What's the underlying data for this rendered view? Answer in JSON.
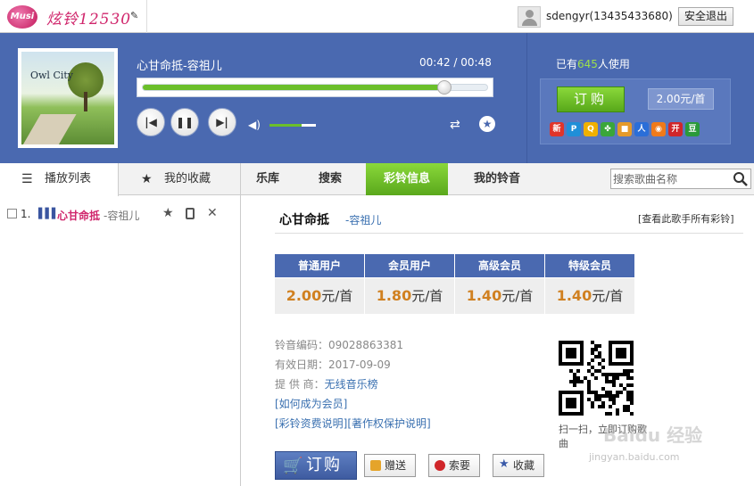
{
  "topbar": {
    "logo_text": "Musi",
    "brand": "炫铃12530",
    "username": "sdengyr(13435433680)",
    "logout_label": "安全退出"
  },
  "player": {
    "song_title": "心甘命抵-容祖儿",
    "cover_title": "Owl City",
    "time": "00:42 / 00:48",
    "progress": 0.875,
    "volume": 0.7,
    "users_prefix": "已有",
    "users_count": "645",
    "users_suffix": "人使用",
    "buy_label": "订购",
    "price": "2.00元/首",
    "share_icons": [
      {
        "name": "sina-weibo-icon",
        "label": "新",
        "color": "#e0342a"
      },
      {
        "name": "ppc-icon",
        "label": "P",
        "color": "#1f8fd8"
      },
      {
        "name": "qzone-icon",
        "label": "Q",
        "color": "#f0b000"
      },
      {
        "name": "clover-icon",
        "label": "✤",
        "color": "#3aa63a"
      },
      {
        "name": "box-icon",
        "label": "■",
        "color": "#e59a2a"
      },
      {
        "name": "renren-icon",
        "label": "人",
        "color": "#2a6ed8"
      },
      {
        "name": "tqq-icon",
        "label": "◉",
        "color": "#f07a1a"
      },
      {
        "name": "kaixin-icon",
        "label": "开",
        "color": "#d0262a"
      },
      {
        "name": "douban-icon",
        "label": "豆",
        "color": "#2a9a3a"
      }
    ]
  },
  "left_tabs": {
    "playlist_label": "播放列表",
    "favorites_label": "我的收藏"
  },
  "playlist": [
    {
      "num": "1.",
      "song": "心甘命抵",
      "artist": "-容祖儿"
    }
  ],
  "right_tabs": [
    "乐库",
    "搜索",
    "彩铃信息",
    "我的铃音"
  ],
  "search": {
    "placeholder": "搜索歌曲名称"
  },
  "detail": {
    "title": "心甘命抵",
    "artist": "-容祖儿",
    "all_link": "[查看此歌手所有彩铃]",
    "price_headers": [
      "普通用户",
      "会员用户",
      "高级会员",
      "特级会员"
    ],
    "prices": [
      {
        "value": "2.00",
        "unit": "元/首"
      },
      {
        "value": "1.80",
        "unit": "元/首"
      },
      {
        "value": "1.40",
        "unit": "元/首"
      },
      {
        "value": "1.40",
        "unit": "元/首"
      }
    ],
    "code_label": "铃音编码：",
    "code": "09028863381",
    "expiry_label": "有效日期：",
    "expiry": "2017-09-09",
    "provider_label": "提 供 商：",
    "provider": "无线音乐榜",
    "member_link": "[如何成为会员]",
    "fee_link": "[彩铃资费说明]",
    "copyright_link": "[著作权保护说明]",
    "qr_caption": "扫一扫，立即订购歌曲",
    "buy_label": "订购",
    "gift_label": "赠送",
    "request_label": "索要",
    "collect_label": "收藏"
  },
  "watermark": {
    "main": "Baidu 经验",
    "sub": "jingyan.baidu.com"
  }
}
